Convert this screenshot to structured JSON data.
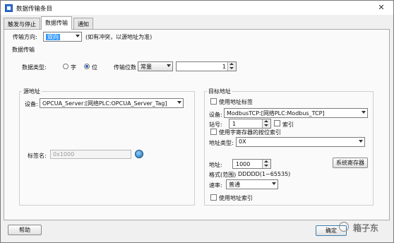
{
  "window": {
    "title": "数据传输条目",
    "close_glyph": "✕"
  },
  "tabs": [
    {
      "label": "触发与停止"
    },
    {
      "label": "数据传输"
    },
    {
      "label": "通知"
    }
  ],
  "transfer_direction": {
    "label": "传输方向:",
    "value": "双向",
    "note": "(如有冲突，以源地址为准)"
  },
  "data_transfer": {
    "group_label": "数据传输",
    "data_type_label": "数据类型:",
    "option_word": "字",
    "option_bit": "位",
    "selected": "位",
    "bit_count_label": "传输位数",
    "bit_count_mode": "常量",
    "bit_count_value": "1"
  },
  "source": {
    "group_label": "源地址",
    "device_label": "设备:",
    "device_value": "OPCUA_Server:[网络PLC:OPCUA_Server_Tag]",
    "tag_label": "标签名:",
    "tag_placeholder": "0x1000"
  },
  "target": {
    "group_label": "目标地址",
    "use_tag_label": "使用地址标签",
    "device_label": "设备:",
    "device_value": "ModbusTCP:[网络PLC:Modbus_TCP]",
    "station_label": "站号:",
    "station_value": "1",
    "index_label": "索引",
    "use_bit_index_label": "使用字寄存器的按位索引",
    "addr_type_label": "地址类型:",
    "addr_type_value": "0X",
    "address_label": "地址:",
    "address_value": "1000",
    "system_register_button": "系统寄存器",
    "format_label": "格式(范围)",
    "format_value": "DDDDD(1~65535)",
    "speed_label": "速率:",
    "speed_value": "普通",
    "use_address_index_label": "使用地址索引"
  },
  "footer": {
    "help_button": "帮助",
    "ok_button": "确定",
    "watermark_text": "箱子东"
  }
}
